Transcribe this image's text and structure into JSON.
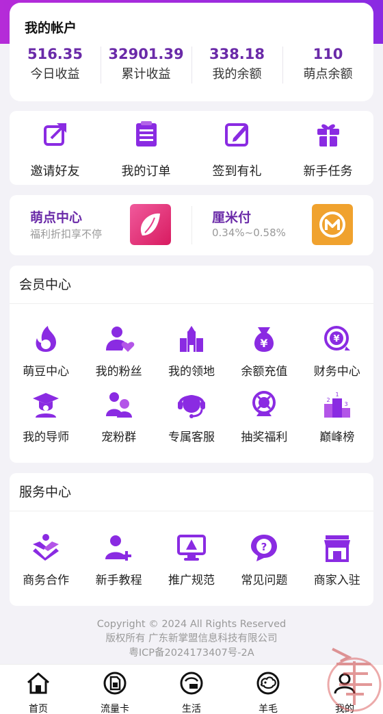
{
  "account": {
    "title": "我的帐户",
    "stats": [
      {
        "value": "516.35",
        "label": "今日收益"
      },
      {
        "value": "32901.39",
        "label": "累计收益"
      },
      {
        "value": "338.18",
        "label": "我的余额"
      },
      {
        "value": "110",
        "label": "萌点余额"
      }
    ]
  },
  "quick_actions": [
    {
      "label": "邀请好友",
      "icon": "share-icon"
    },
    {
      "label": "我的订单",
      "icon": "order-list-icon"
    },
    {
      "label": "签到有礼",
      "icon": "edit-sign-icon"
    },
    {
      "label": "新手任务",
      "icon": "gift-icon"
    }
  ],
  "promos": [
    {
      "title": "萌点中心",
      "subtitle": "福利折扣享不停",
      "icon": "mengdian-logo"
    },
    {
      "title": "厘米付",
      "subtitle": "0.34%~0.58%",
      "icon": "limifu-logo"
    }
  ],
  "member_center": {
    "title": "会员中心",
    "items": [
      {
        "label": "萌豆中心",
        "icon": "flame-icon"
      },
      {
        "label": "我的粉丝",
        "icon": "user-heart-icon"
      },
      {
        "label": "我的领地",
        "icon": "castle-icon"
      },
      {
        "label": "余额充值",
        "icon": "money-bag-icon"
      },
      {
        "label": "财务中心",
        "icon": "yuan-coin-icon"
      },
      {
        "label": "我的导师",
        "icon": "graduation-icon"
      },
      {
        "label": "宠粉群",
        "icon": "group-icon"
      },
      {
        "label": "专属客服",
        "icon": "headset-icon"
      },
      {
        "label": "抽奖福利",
        "icon": "lottery-icon"
      },
      {
        "label": "巅峰榜",
        "icon": "podium-icon"
      }
    ]
  },
  "service_center": {
    "title": "服务中心",
    "items": [
      {
        "label": "商务合作",
        "icon": "handshake-icon"
      },
      {
        "label": "新手教程",
        "icon": "user-add-icon"
      },
      {
        "label": "推广规范",
        "icon": "monitor-warning-icon"
      },
      {
        "label": "常见问题",
        "icon": "question-icon"
      },
      {
        "label": "商家入驻",
        "icon": "store-icon"
      }
    ]
  },
  "footer": {
    "line1": "Copyright © 2024 All Rights Reserved",
    "line2": "版权所有 广东新掌盟信息科技有限公司",
    "line3": "粤ICP备2024173407号-2A"
  },
  "tabs": [
    {
      "label": "首页",
      "icon": "home-icon"
    },
    {
      "label": "流量卡",
      "icon": "sim-card-icon"
    },
    {
      "label": "生活",
      "icon": "life-icon"
    },
    {
      "label": "羊毛",
      "icon": "sheep-icon"
    },
    {
      "label": "我的",
      "icon": "profile-icon"
    }
  ],
  "colors": {
    "accent": "#8a2be2",
    "value": "#6a2aa8"
  }
}
